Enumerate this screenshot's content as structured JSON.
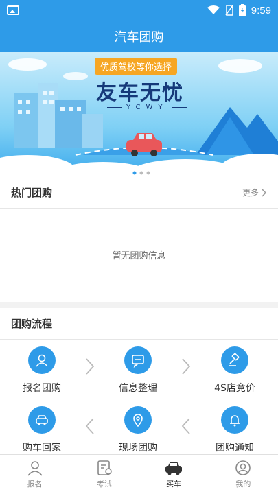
{
  "status_bar": {
    "time": "9:59"
  },
  "header": {
    "title": "汽车团购"
  },
  "banner": {
    "tag": "优质驾校等你选择",
    "title": "友车无忧",
    "subtitle": "YCWY"
  },
  "hot_group": {
    "title": "热门团购",
    "more_label": "更多",
    "empty_text": "暂无团购信息"
  },
  "process": {
    "title": "团购流程",
    "steps": [
      {
        "label": "报名团购",
        "icon": "user-icon"
      },
      {
        "label": "信息整理",
        "icon": "chat-icon"
      },
      {
        "label": "4S店竞价",
        "icon": "gavel-icon"
      },
      {
        "label": "购车回家",
        "icon": "car-icon"
      },
      {
        "label": "现场团购",
        "icon": "location-icon"
      },
      {
        "label": "团购通知",
        "icon": "bell-icon"
      }
    ]
  },
  "tabbar": {
    "items": [
      {
        "label": "报名",
        "icon": "person-icon"
      },
      {
        "label": "考试",
        "icon": "exam-icon"
      },
      {
        "label": "买车",
        "icon": "car-icon",
        "active": true
      },
      {
        "label": "我的",
        "icon": "profile-icon"
      }
    ]
  },
  "colors": {
    "primary": "#2e9be8",
    "banner_tag": "#f6a623"
  }
}
